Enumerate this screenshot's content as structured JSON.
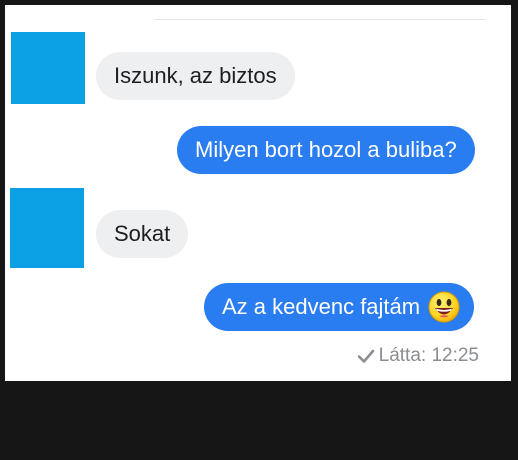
{
  "colors": {
    "outer_background": "#161616",
    "panel_background": "#ffffff",
    "avatar": "#0aa0e3",
    "incoming_bubble": "#eeeff1",
    "outgoing_bubble": "#2a7df0",
    "seen_text": "#8a8d91"
  },
  "messages": [
    {
      "direction": "incoming",
      "text": "Iszunk, az biztos"
    },
    {
      "direction": "outgoing",
      "text": "Milyen bort hozol a buliba?"
    },
    {
      "direction": "incoming",
      "text": "Sokat"
    },
    {
      "direction": "outgoing",
      "text": "Az a kedvenc fajtám",
      "emoji": "grinning-face-emoji"
    }
  ],
  "seen_status": {
    "icon": "check-icon",
    "label": "Látta: 12:25"
  }
}
